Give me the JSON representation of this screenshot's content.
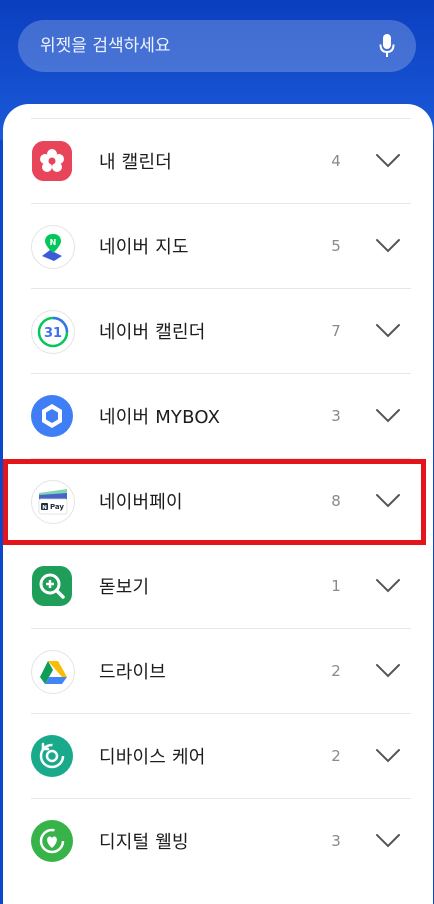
{
  "search": {
    "placeholder": "위젯을 검색하세요",
    "mic_icon": "mic-icon"
  },
  "widgets": [
    {
      "label": "내 캘린더",
      "count": "4",
      "icon": "my-calendar-icon"
    },
    {
      "label": "네이버 지도",
      "count": "5",
      "icon": "naver-map-icon"
    },
    {
      "label": "네이버 캘린더",
      "count": "7",
      "icon": "naver-calendar-icon",
      "icon_text": "31"
    },
    {
      "label": "네이버 MYBOX",
      "count": "3",
      "icon": "naver-mybox-icon"
    },
    {
      "label": "네이버페이",
      "count": "8",
      "icon": "naver-pay-icon",
      "icon_text": "Pay",
      "icon_badge": "N"
    },
    {
      "label": "돋보기",
      "count": "1",
      "icon": "magnifier-icon"
    },
    {
      "label": "드라이브",
      "count": "2",
      "icon": "drive-icon"
    },
    {
      "label": "디바이스 케어",
      "count": "2",
      "icon": "device-care-icon"
    },
    {
      "label": "디지털 웰빙",
      "count": "3",
      "icon": "digital-wellbeing-icon"
    }
  ],
  "colors": {
    "header": "#0b3fc0",
    "highlight": "#e3151a"
  }
}
